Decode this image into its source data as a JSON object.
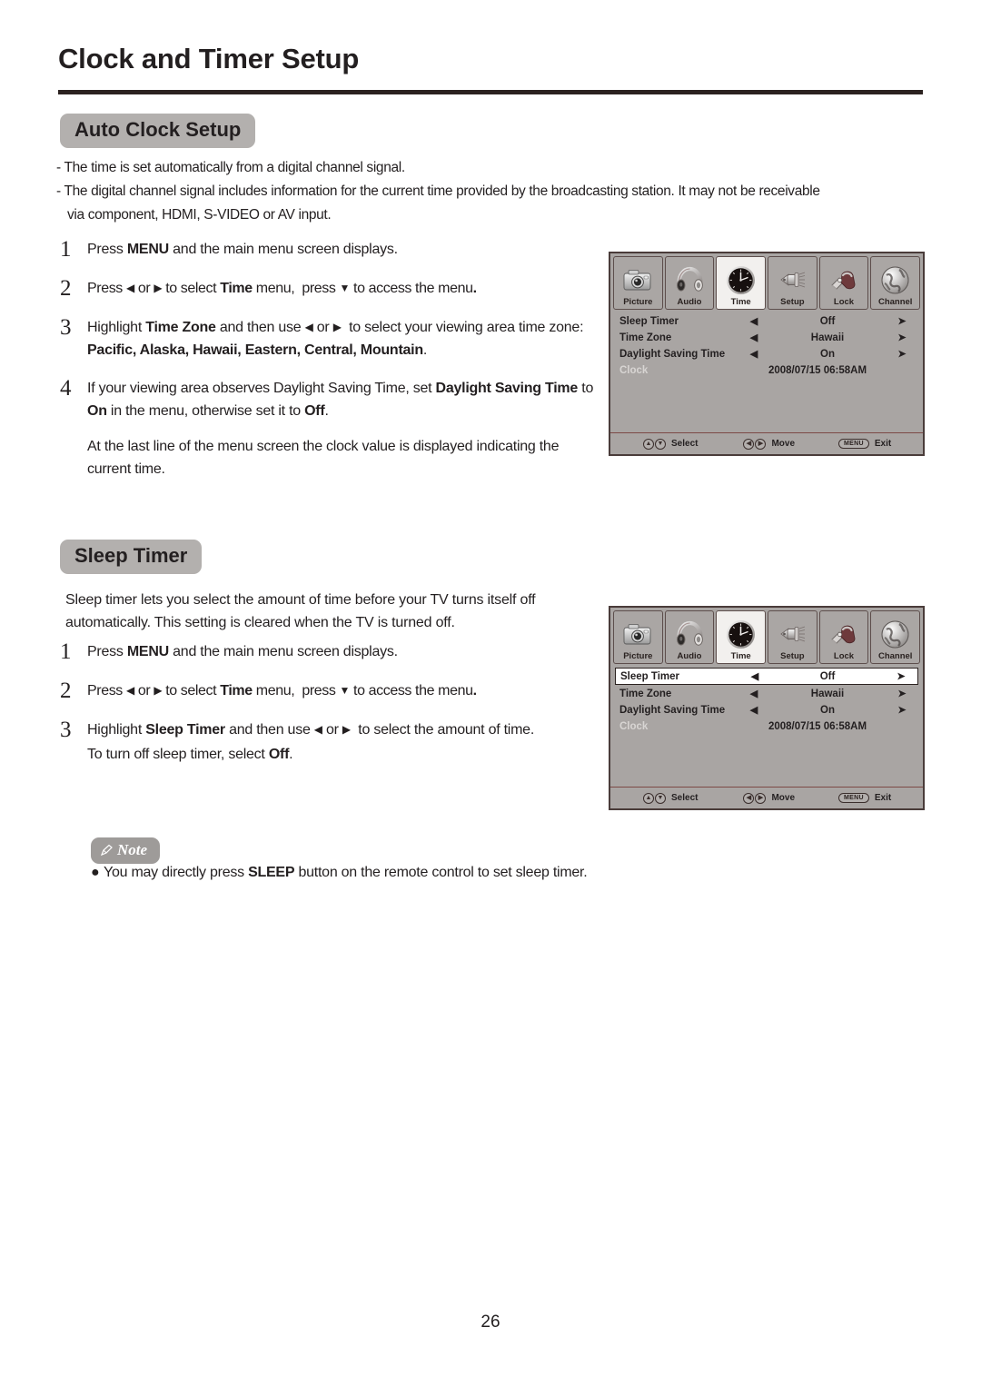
{
  "document": {
    "title": "Clock and Timer Setup",
    "page_number": "26"
  },
  "sections": {
    "auto_clock": {
      "heading": "Auto Clock Setup",
      "notes": [
        "- The time is set automatically from a digital channel signal.",
        "- The digital channel signal includes information for the current time provided by the broadcasting station. It may not be receivable",
        "via component, HDMI, S-VIDEO or AV input."
      ],
      "steps": [
        {
          "num": "1",
          "html": "Press <b>MENU</b> and the main menu screen displays."
        },
        {
          "num": "2",
          "html": "Press <span class='arr'>◀</span> or <span class='arr'>▶</span> to select <b>Time</b> menu,&nbsp; press <span class='arr'>▼</span> to access the menu<b>.</b>"
        },
        {
          "num": "3",
          "html": "Highlight <b>Time Zone</b> and then use <span class='arr'>◀</span> or <span class='arr'>▶</span>&nbsp; to select your viewing area time zone: <b>Pacific, Alaska, Hawaii, Eastern, Central, Mountain</b>."
        },
        {
          "num": "4",
          "html": "If your viewing area observes Daylight Saving Time, set <b>Daylight Saving Time</b> to <b>On</b> in the menu, otherwise set it to <b>Off</b>."
        }
      ],
      "closing": "At the last line of the menu screen the clock value is displayed indicating the current time."
    },
    "sleep_timer": {
      "heading": "Sleep Timer",
      "intro": "Sleep timer lets you select the amount of time before your TV turns itself off automatically. This setting is cleared when the TV is turned off.",
      "steps": [
        {
          "num": "1",
          "html": "Press <b>MENU</b> and the main menu screen displays."
        },
        {
          "num": "2",
          "html": "Press <span class='arr'>◀</span> or <span class='arr'>▶</span> to select <b>Time</b> menu,&nbsp; press <span class='arr'>▼</span> to access the menu<b>.</b>"
        },
        {
          "num": "3",
          "html": "Highlight <b>Sleep Timer</b> and then use <span class='arr'>◀</span> or <span class='arr'>▶</span>&nbsp; to select the amount of time."
        }
      ],
      "closing": "To turn off sleep timer, select <b>Off</b>."
    },
    "note": {
      "label": "Note",
      "bullet": "●",
      "html": "You may directly press <b>SLEEP</b> button on the remote control to set sleep timer."
    }
  },
  "osd": {
    "tabs": [
      {
        "label": "Picture",
        "icon": "camera-icon",
        "active": false
      },
      {
        "label": "Audio",
        "icon": "headphones-icon",
        "active": false
      },
      {
        "label": "Time",
        "icon": "clock-icon",
        "active": true
      },
      {
        "label": "Setup",
        "icon": "connector-icon",
        "active": false
      },
      {
        "label": "Lock",
        "icon": "padlock-icon",
        "active": false
      },
      {
        "label": "Channel",
        "icon": "globe-icon",
        "active": false
      }
    ],
    "left_arrow": "◀",
    "right_arrow": "➤",
    "rows": [
      {
        "label": "Sleep Timer",
        "value": "Off",
        "arrows": true,
        "dim": false
      },
      {
        "label": "Time Zone",
        "value": "Hawaii",
        "arrows": true,
        "dim": false
      },
      {
        "label": "Daylight Saving Time",
        "value": "On",
        "arrows": true,
        "dim": false
      },
      {
        "label": "Clock",
        "value": "2008/07/15  06:58AM",
        "arrows": false,
        "dim": true
      }
    ],
    "footer": {
      "select_keys": [
        "A",
        "Y"
      ],
      "select_label": "Select",
      "move_keys": [
        "◂",
        "▸"
      ],
      "move_label": "Move",
      "menu_key": "MENU",
      "exit_label": "Exit"
    },
    "selected_row_index_panel1": -1,
    "selected_row_index_panel2": 0
  },
  "colors": {
    "rule": "#2b2220",
    "pill_bg": "#b3b0ae",
    "note_pill_bg": "#9e9b99",
    "osd_bg": "#a9a5a3",
    "osd_border": "#4a3c3a",
    "osd_dim_text": "#d8d5d3",
    "text": "#231f20"
  }
}
